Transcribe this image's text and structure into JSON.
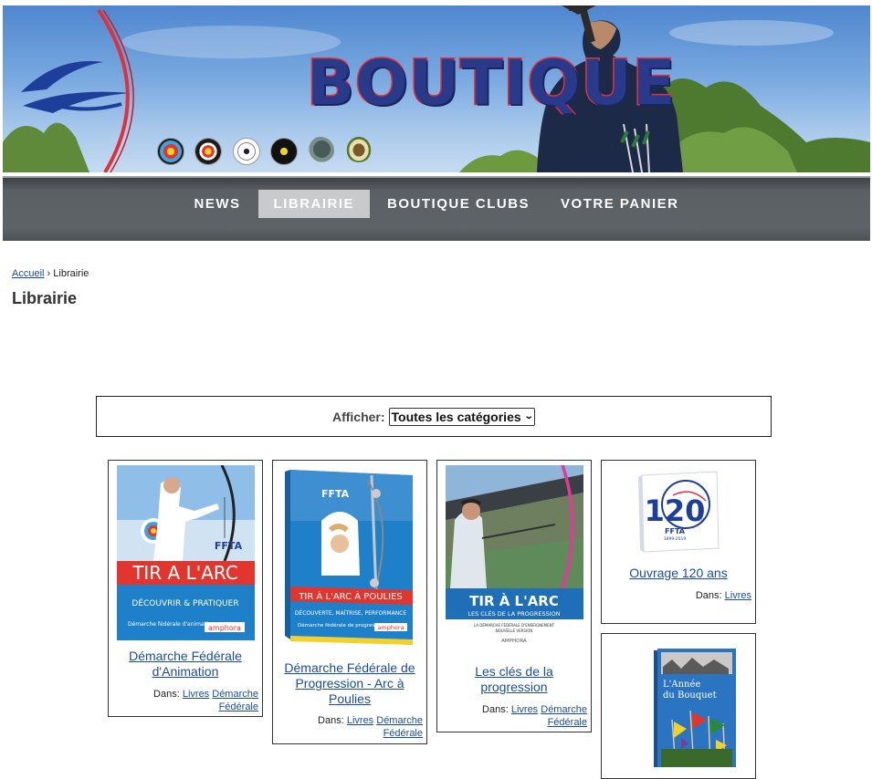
{
  "banner": {
    "title": "BOUTIQUE",
    "target_icons": [
      "target-fita-icon",
      "target-black-center-icon",
      "target-white-icon",
      "target-black-icon",
      "boar-target-icon",
      "bird-target-icon"
    ]
  },
  "nav": {
    "items": [
      {
        "label": "NEWS",
        "active": false
      },
      {
        "label": "LIBRAIRIE",
        "active": true
      },
      {
        "label": "BOUTIQUE CLUBS",
        "active": false
      },
      {
        "label": "VOTRE PANIER",
        "active": false
      }
    ]
  },
  "breadcrumb": {
    "home": "Accueil",
    "separator": "›",
    "current": "Librairie"
  },
  "page": {
    "title": "Librairie"
  },
  "filter": {
    "label": "Afficher:",
    "selected": "Toutes les catégories"
  },
  "products": [
    {
      "title": "Démarche Fédérale d'Animation",
      "cats_prefix": "Dans:",
      "cat1": "Livres",
      "cat2": "Démarche Fédérale",
      "cover": {
        "top_text": "FFTA",
        "band_text": "TIR A L'ARC",
        "sub_text": "DÉCOUVRIR & PRATIQUER",
        "small_text": "Démarche fédérale d'animation",
        "publisher": "amphora"
      }
    },
    {
      "title": "Démarche Fédérale de Progression - Arc à Poulies",
      "cats_prefix": "Dans:",
      "cat1": "Livres",
      "cat2": "Démarche Fédérale",
      "cover": {
        "top_text": "FFTA",
        "band_text": "TIR À L'ARC À POULIES",
        "sub_text": "DÉCOUVERTE, MAÎTRISE, PERFORMANCE",
        "small_text": "Démarche fédérale de progression",
        "publisher": "amphora"
      }
    },
    {
      "title": "Les clés de la progression",
      "cats_prefix": "Dans:",
      "cat1": "Livres",
      "cat2": "Démarche Fédérale",
      "cover": {
        "band_text": "TIR À L'ARC",
        "band_sub": "LES CLÉS DE LA PROGRESSION",
        "small_text": "LA DÉMARCHE FÉDÉRALE D'ENSEIGNEMENT",
        "small_text2": "NOUVELLE VERSION",
        "publisher": "AMPHORA"
      }
    },
    {
      "title": "Ouvrage 120 ans",
      "cats_prefix": "Dans:",
      "cat1": "Livres",
      "cover": {
        "big_number": "120",
        "sub": "ans",
        "brand": "FFTA",
        "years": "1899-2019"
      }
    },
    {
      "title": "",
      "cover": {
        "line1": "L'Année",
        "line2": "du Bouquet"
      }
    }
  ],
  "colors": {
    "nav_bg": "#5d6366",
    "nav_active": "#c9cacb",
    "link": "#1a4c9e",
    "banner_title": "#2a3a8a",
    "banner_title_outline": "#e0303a"
  }
}
